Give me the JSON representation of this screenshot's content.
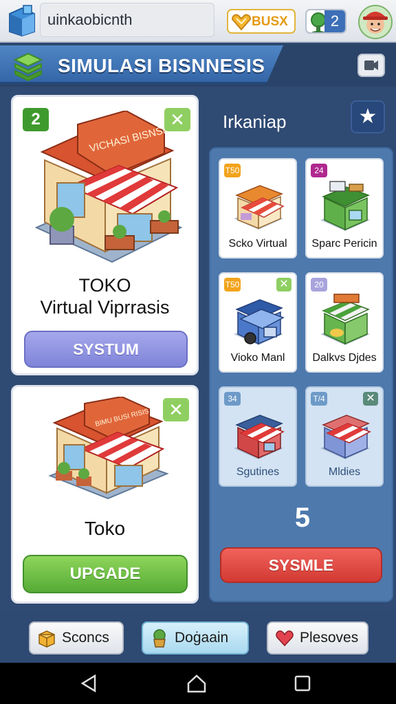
{
  "topbar": {
    "app_title": "uinkaobicnth",
    "currency_label": "BUSX",
    "players_count": "2"
  },
  "header": {
    "title": "SIMULASI BISNNESIS"
  },
  "left_cards": [
    {
      "level": "2",
      "sign_text": "VICHASI BISNSIA",
      "title_line1": "TOKO",
      "title_line2": "Virtual Viprrasis",
      "button_label": "SYSTUM"
    },
    {
      "sign_text": "BIMU BUSI RISIS",
      "title": "Toko",
      "button_label": "UPGADE"
    }
  ],
  "shop_panel": {
    "title": "Irkaniap",
    "items": [
      {
        "badge": "T50",
        "label": "Scko Virtual",
        "badge_color": "#f2a31b",
        "has_close": false,
        "dim": false
      },
      {
        "badge": "24",
        "label": "Sparc Pericin",
        "badge_color": "#b0288f",
        "has_close": false,
        "dim": false
      },
      {
        "badge": "T50",
        "label": "Vioko Manl",
        "badge_color": "#f2a31b",
        "has_close": true,
        "dim": false
      },
      {
        "badge": "20",
        "label": "Dalkvs Djdes",
        "badge_color": "#a9a3dd",
        "has_close": false,
        "dim": false
      },
      {
        "badge": "34",
        "label": "Sgutines",
        "badge_color": "#6d9ac8",
        "has_close": false,
        "dim": true
      },
      {
        "badge": "T/4",
        "label": "Mldies",
        "badge_color": "#6d9ac8",
        "has_close": true,
        "dim": true
      }
    ],
    "count": "5",
    "button_label": "SYSMLE"
  },
  "bottom_tabs": [
    {
      "label": "Sconcs",
      "icon": "box-icon"
    },
    {
      "label": "Doġaain",
      "icon": "plant-icon"
    },
    {
      "label": "Plesoves",
      "icon": "heart-icon"
    }
  ]
}
